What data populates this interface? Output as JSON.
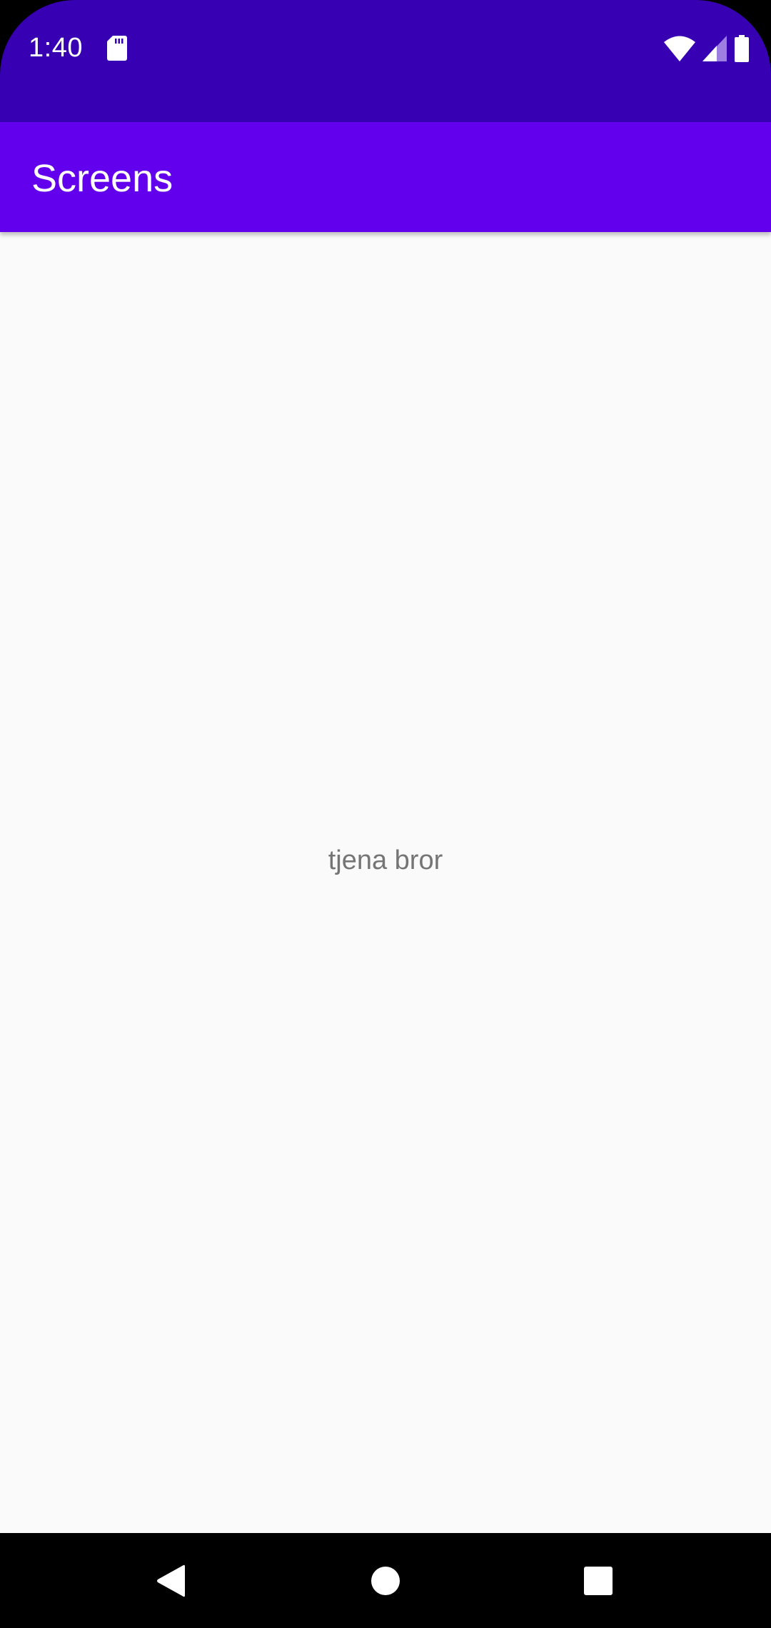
{
  "status_bar": {
    "time": "1:40",
    "icons": [
      "sd-card-icon",
      "wifi-icon",
      "cell-signal-icon",
      "battery-icon"
    ],
    "color": "#3700b3"
  },
  "app_bar": {
    "title": "Screens",
    "color": "#6200ee"
  },
  "main": {
    "text": "tjena bror",
    "background": "#fafafa"
  },
  "nav_bar": {
    "buttons": [
      "back-icon",
      "home-icon",
      "recents-icon"
    ]
  }
}
